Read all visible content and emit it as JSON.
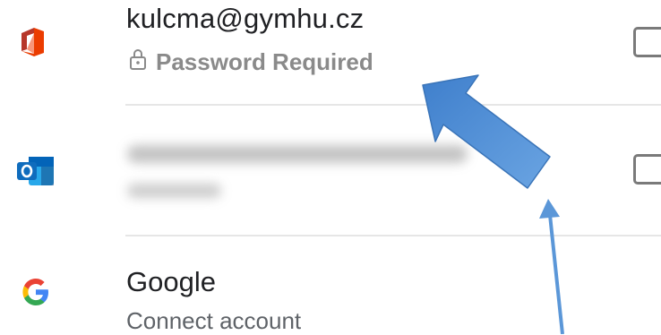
{
  "accounts": [
    {
      "email": "kulcma@gymhu.cz",
      "status": "Password Required",
      "icon": "office-icon"
    },
    {
      "icon": "outlook-icon"
    },
    {
      "title": "Google",
      "subtitle": "Connect account",
      "icon": "google-icon"
    }
  ],
  "colors": {
    "office_red": "#d83b01",
    "outlook_blue": "#0f6cbd",
    "arrow_blue": "#4f8fd6"
  }
}
